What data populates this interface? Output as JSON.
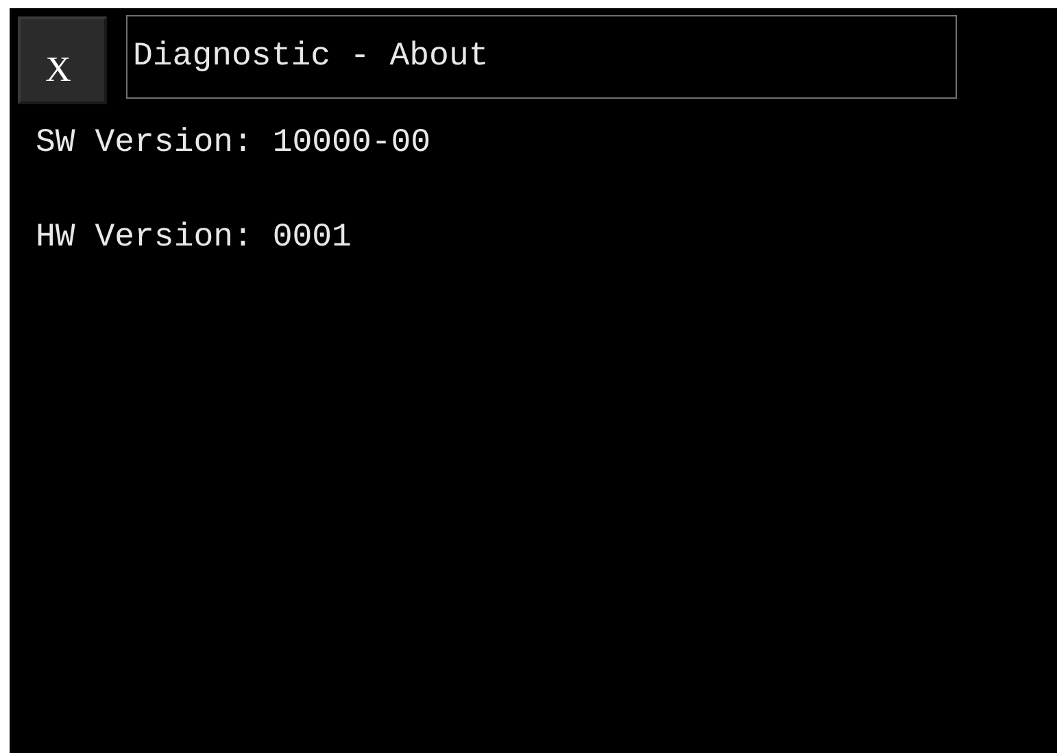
{
  "close_button": {
    "label": "X"
  },
  "title": "Diagnostic - About",
  "lines": [
    {
      "text": "SW Version: 10000-00"
    },
    {
      "text": "HW Version: 0001"
    }
  ]
}
